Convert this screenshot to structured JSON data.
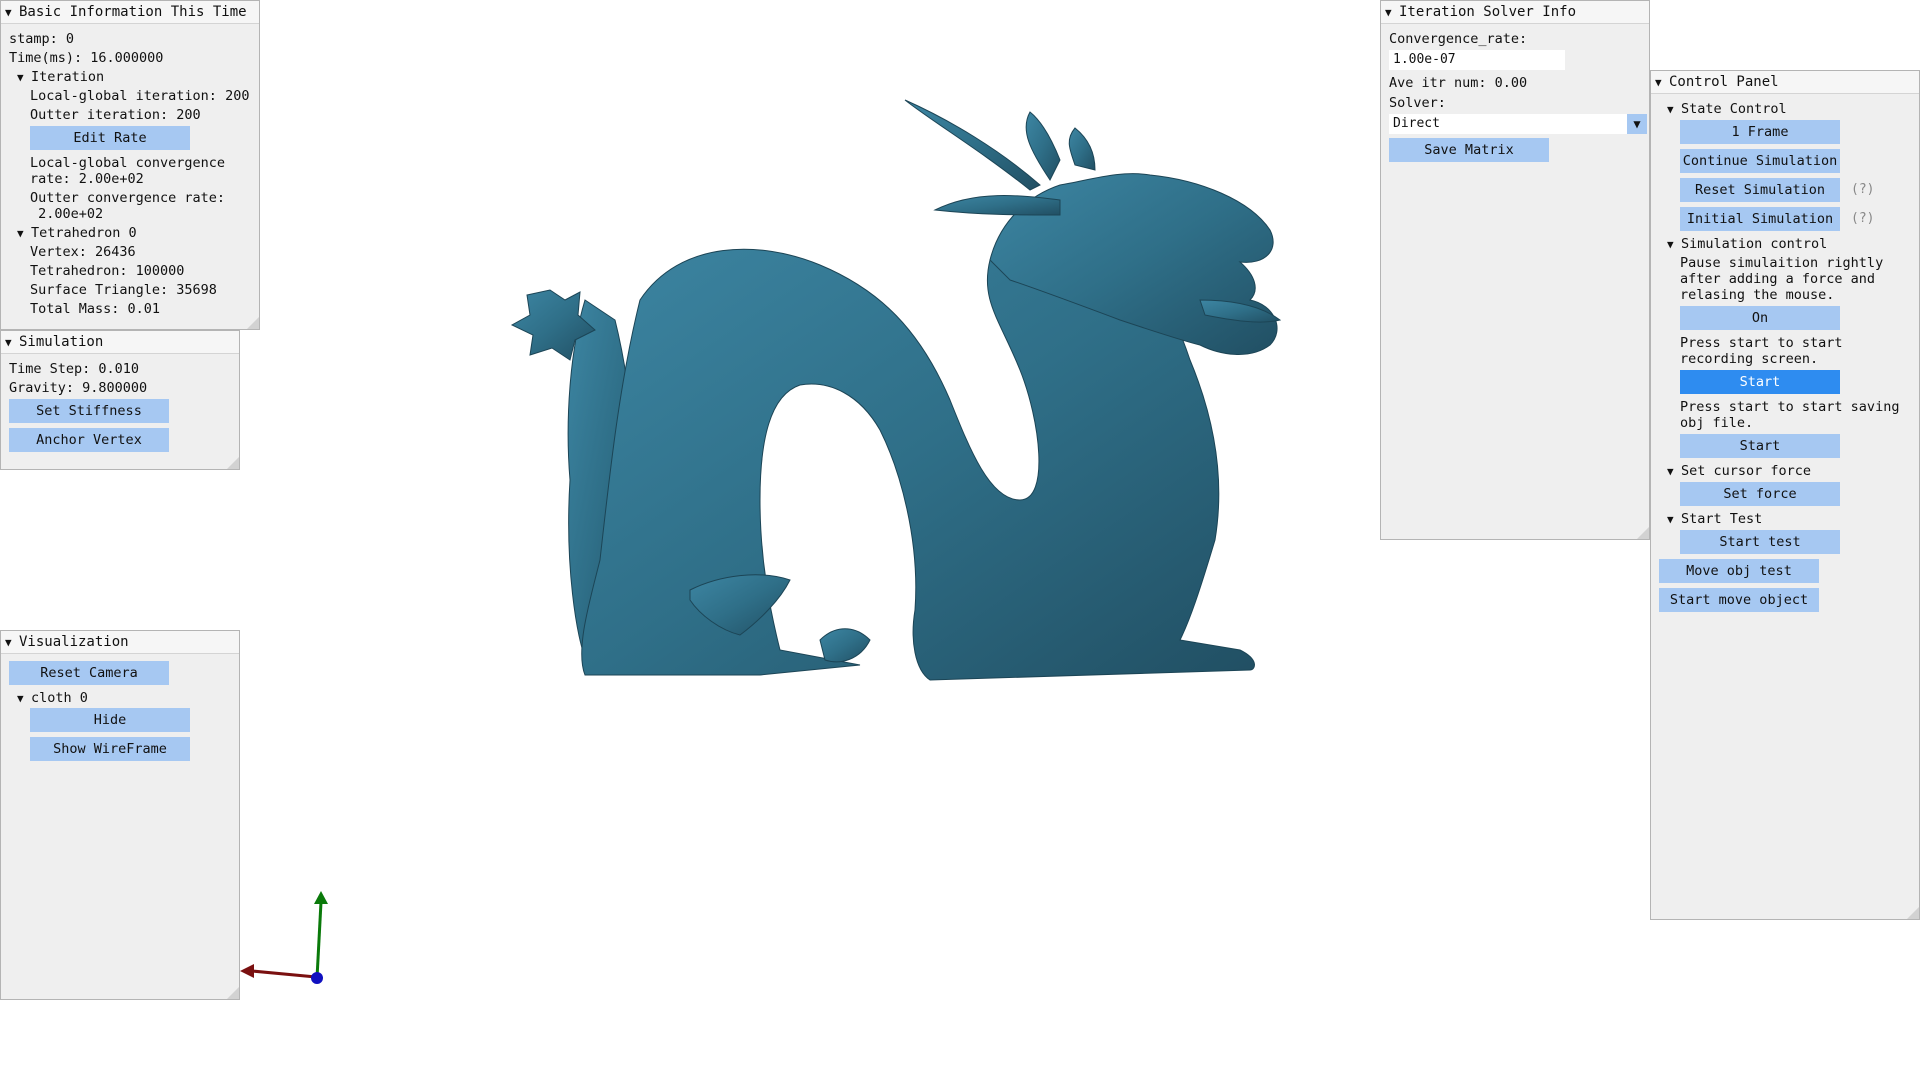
{
  "basic_info": {
    "title": "Basic Information This Time",
    "stamp": "stamp: 0",
    "time": "Time(ms): 16.000000",
    "iteration_header": "Iteration",
    "local_global_iteration": "Local-global iteration: 200",
    "outter_iteration": "Outter iteration: 200",
    "edit_rate_label": "Edit Rate",
    "local_global_convergence_1": "Local-global convergence",
    "local_global_convergence_2": "rate: 2.00e+02",
    "outter_convergence_1": "Outter convergence rate:",
    "outter_convergence_2": " 2.00e+02",
    "tetra_header": "Tetrahedron 0",
    "vertex": "Vertex: 26436",
    "tetrahedron": "Tetrahedron: 100000",
    "surface_triangle": "Surface Triangle: 35698",
    "total_mass": "Total Mass: 0.01"
  },
  "simulation": {
    "title": "Simulation",
    "time_step": "Time Step: 0.010",
    "gravity": "Gravity: 9.800000",
    "set_stiffness_label": "Set Stiffness",
    "anchor_vertex_label": "Anchor Vertex"
  },
  "visualization": {
    "title": "Visualization",
    "reset_camera_label": "Reset Camera",
    "cloth_header": "cloth 0",
    "hide_label": "Hide",
    "show_wireframe_label": "Show WireFrame"
  },
  "solver_info": {
    "title": "Iteration Solver Info",
    "convergence_label": "Convergence_rate:",
    "convergence_value": "1.00e-07",
    "ave_itr": "Ave itr num: 0.00",
    "solver_label": "Solver:",
    "solver_value": "Direct",
    "save_matrix_label": "Save Matrix"
  },
  "control_panel": {
    "title": "Control Panel",
    "state_control_header": "State Control",
    "one_frame_label": "1 Frame",
    "continue_simulation_label": "Continue Simulation",
    "reset_simulation_label": "Reset Simulation",
    "initial_simulation_label": "Initial Simulation",
    "help_mark": "(?)",
    "simulation_control_header": "Simulation control",
    "pause_text_1": "Pause simulaition rightly",
    "pause_text_2": "after adding a force and",
    "pause_text_3": "relasing the mouse.",
    "on_label": "On",
    "record_text_1": "Press start to start",
    "record_text_2": "recording screen.",
    "start_record_label": "Start",
    "save_obj_text_1": "Press start to start saving",
    "save_obj_text_2": "obj file.",
    "start_save_label": "Start",
    "cursor_force_header": "Set cursor force",
    "set_force_label": "Set force",
    "start_test_header": "Start Test",
    "start_test_label": "Start test",
    "move_obj_test_label": "Move obj test",
    "start_move_object_label": "Start move object"
  },
  "colors": {
    "model": "#2f6f88",
    "button": "#a6c8f2",
    "button_active": "#2e8cf0",
    "panel_bg": "#efefef",
    "axis_x": "#7a1010",
    "axis_y": "#0a7a0a",
    "axis_z": "#1010c0"
  },
  "icons": {
    "collapse": "triangle-down-icon",
    "select_arrow": "triangle-down-icon"
  }
}
